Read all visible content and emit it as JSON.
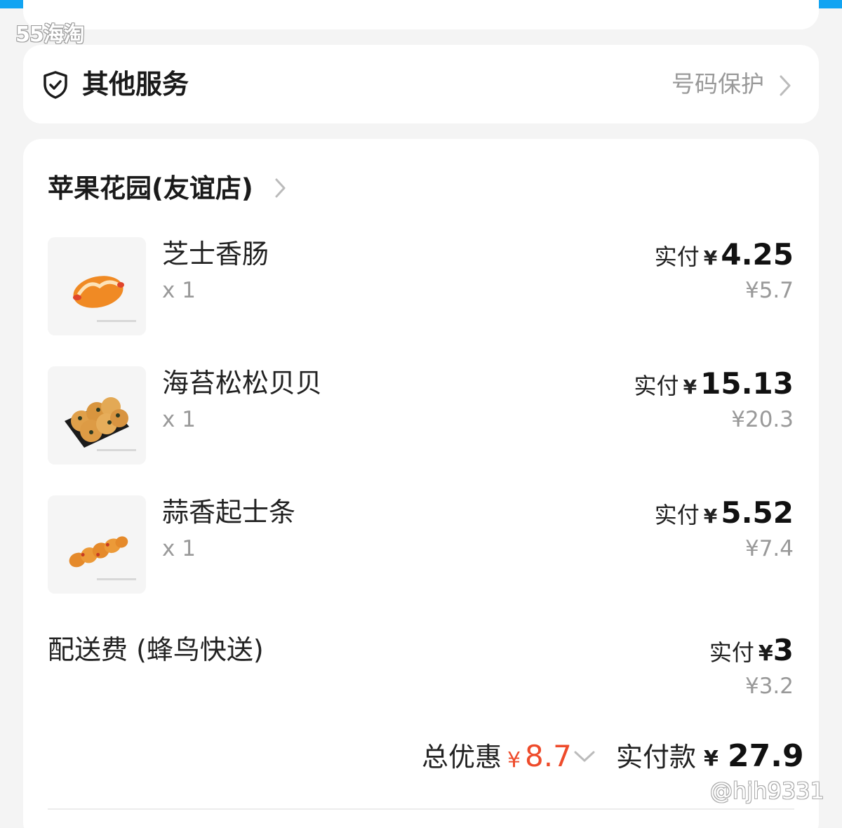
{
  "watermark_top": "55海淘",
  "watermark_bottom": "@hjh9331",
  "service": {
    "title": "其他服务",
    "right_label": "号码保护"
  },
  "store": {
    "name": "苹果花园(友谊店)"
  },
  "items": [
    {
      "name": "芝士香肠",
      "qty": "x 1",
      "paid_label": "实付",
      "currency": "¥",
      "paid": "4.25",
      "original": "¥5.7"
    },
    {
      "name": "海苔松松贝贝",
      "qty": "x 1",
      "paid_label": "实付",
      "currency": "¥",
      "paid": "15.13",
      "original": "¥20.3"
    },
    {
      "name": "蒜香起士条",
      "qty": "x 1",
      "paid_label": "实付",
      "currency": "¥",
      "paid": "5.52",
      "original": "¥7.4"
    }
  ],
  "delivery": {
    "label": "配送费 (蜂鸟快送)",
    "paid_label": "实付",
    "currency": "¥",
    "paid": "3",
    "original": "¥3.2"
  },
  "totals": {
    "discount_label": "总优惠",
    "discount_currency": "¥",
    "discount": "8.7",
    "pay_label": "实付款",
    "pay_currency": "¥",
    "pay": "27.9"
  },
  "colors": {
    "accent_blue": "#12a4f2",
    "discount_red": "#ee4b2b",
    "muted_gray": "#999999"
  }
}
